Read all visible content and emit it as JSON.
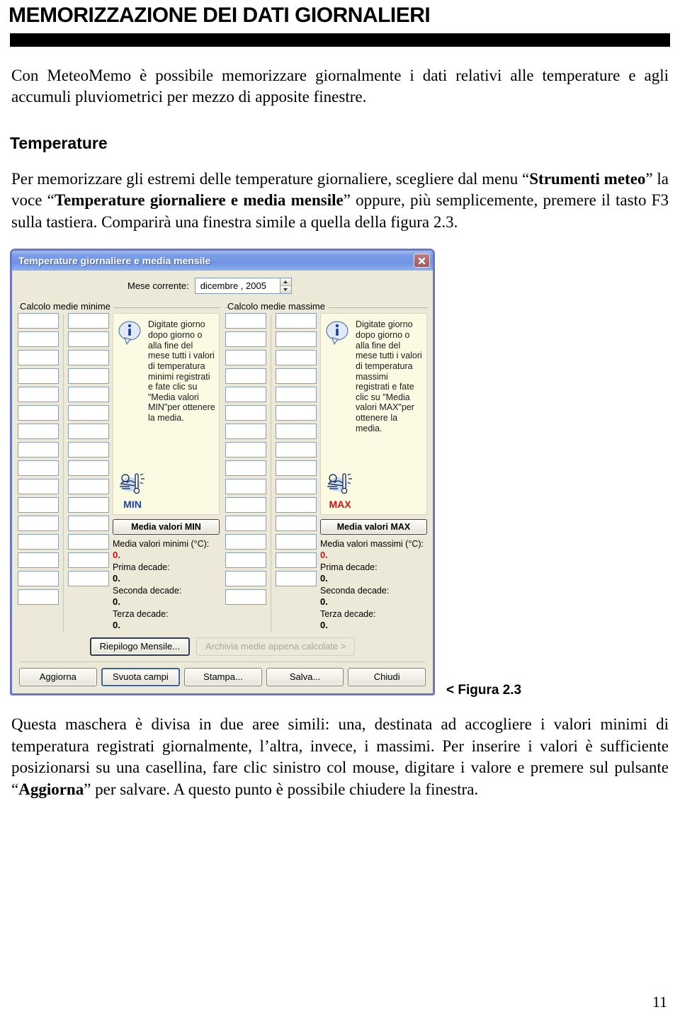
{
  "document": {
    "title": "MEMORIZZAZIONE DEI DATI GIORNALIERI",
    "intro_paragraph": "Con MeteoMemo è possibile memorizzare giornalmente i dati relativi alle temperature e agli accumuli pluviometrici per mezzo di apposite finestre.",
    "section_heading": "Temperature",
    "body_paragraph_1a": "Per memorizzare gli estremi delle temperature giornaliere, scegliere dal menu “",
    "body_paragraph_1b": "Strumenti meteo",
    "body_paragraph_1c": "” la voce “",
    "body_paragraph_1d": "Temperature giornaliere e media mensile",
    "body_paragraph_1e": "” oppure, più semplicemente, premere il tasto F3 sulla tastiera. Comparirà una finestra simile a quella della figura 2.3.",
    "figure_caption": "< Figura 2.3",
    "outro_paragraph_a": "Questa maschera è divisa in due aree simili: una, destinata ad accogliere i valori minimi di temperatura registrati giornalmente, l’altra, invece, i massimi. Per inserire i valori è sufficiente posizionarsi su una casellina, fare clic sinistro col mouse, digitare i valore e premere sul pulsante “",
    "outro_paragraph_b": "Aggiorna",
    "outro_paragraph_c": "” per salvare. A questo punto è possibile chiudere la finestra.",
    "page_number": "11"
  },
  "dialog": {
    "title": "Temperature giornaliere e media mensile",
    "close_icon": "close-icon",
    "month": {
      "label": "Mese corrente:",
      "value": "dicembre , 2005",
      "spin_up_icon": "chevron-up-icon",
      "spin_down_icon": "chevron-down-icon"
    },
    "panes": [
      {
        "id": "min",
        "legend": "Calcolo medie minime",
        "info_icon": "info-icon",
        "info_text": "Digitate giorno dopo giorno o alla fine del mese tutti i valori di temperatura minimi registrati e fate clic su \"Media valori MIN\"per ottenere la media.",
        "badge_icon": "weather-thermometer-icon",
        "badge_label": "MIN",
        "badge_color": "#1f3fb0",
        "avg_button": "Media valori MIN",
        "results": [
          {
            "label": "Media valori minimi (°C):",
            "value": "0.",
            "color": "#cc1111"
          },
          {
            "label": "Prima decade:",
            "value": "0.",
            "color": "#000000"
          },
          {
            "label": "Seconda decade:",
            "value": "0.",
            "color": "#000000"
          },
          {
            "label": "Terza decade:",
            "value": "0.",
            "color": "#000000"
          }
        ],
        "day_fields_col1": [
          "",
          "",
          "",
          "",
          "",
          "",
          "",
          "",
          "",
          "",
          "",
          "",
          "",
          "",
          "",
          ""
        ],
        "day_fields_col2": [
          "",
          "",
          "",
          "",
          "",
          "",
          "",
          "",
          "",
          "",
          "",
          "",
          "",
          "",
          ""
        ]
      },
      {
        "id": "max",
        "legend": "Calcolo medie massime",
        "info_icon": "info-icon",
        "info_text": "Digitate giorno dopo giorno o alla fine del mese tutti i valori di temperatura massimi registrati e fate clic su \"Media valori MAX\"per ottenere la media.",
        "badge_icon": "weather-thermometer-icon",
        "badge_label": "MAX",
        "badge_color": "#cc1111",
        "avg_button": "Media valori MAX",
        "results": [
          {
            "label": "Media valori massimi (°C):",
            "value": "0.",
            "color": "#cc1111"
          },
          {
            "label": "Prima decade:",
            "value": "0.",
            "color": "#000000"
          },
          {
            "label": "Seconda decade:",
            "value": "0.",
            "color": "#000000"
          },
          {
            "label": "Terza decade:",
            "value": "0.",
            "color": "#000000"
          }
        ],
        "day_fields_col1": [
          "",
          "",
          "",
          "",
          "",
          "",
          "",
          "",
          "",
          "",
          "",
          "",
          "",
          "",
          "",
          ""
        ],
        "day_fields_col2": [
          "",
          "",
          "",
          "",
          "",
          "",
          "",
          "",
          "",
          "",
          "",
          "",
          "",
          "",
          ""
        ]
      }
    ],
    "secondary_buttons": [
      {
        "label": "Riepilogo Mensile...",
        "state": "default"
      },
      {
        "label": "Archivia medie appena calcolate >",
        "state": "disabled"
      }
    ],
    "primary_buttons": [
      {
        "label": "Aggiorna",
        "state": "normal"
      },
      {
        "label": "Svuota campi",
        "state": "focused"
      },
      {
        "label": "Stampa...",
        "state": "normal"
      },
      {
        "label": "Salva...",
        "state": "normal"
      },
      {
        "label": "Chiudi",
        "state": "normal"
      }
    ]
  },
  "colors": {
    "titlebar_blue": "#7b9ee8",
    "dialog_face": "#ece9d8",
    "dialog_border": "#6a77c8",
    "info_panel": "#fbfbe4",
    "close_red": "#b06a70",
    "accent_red": "#cc1111",
    "accent_blue": "#1f3fb0"
  }
}
